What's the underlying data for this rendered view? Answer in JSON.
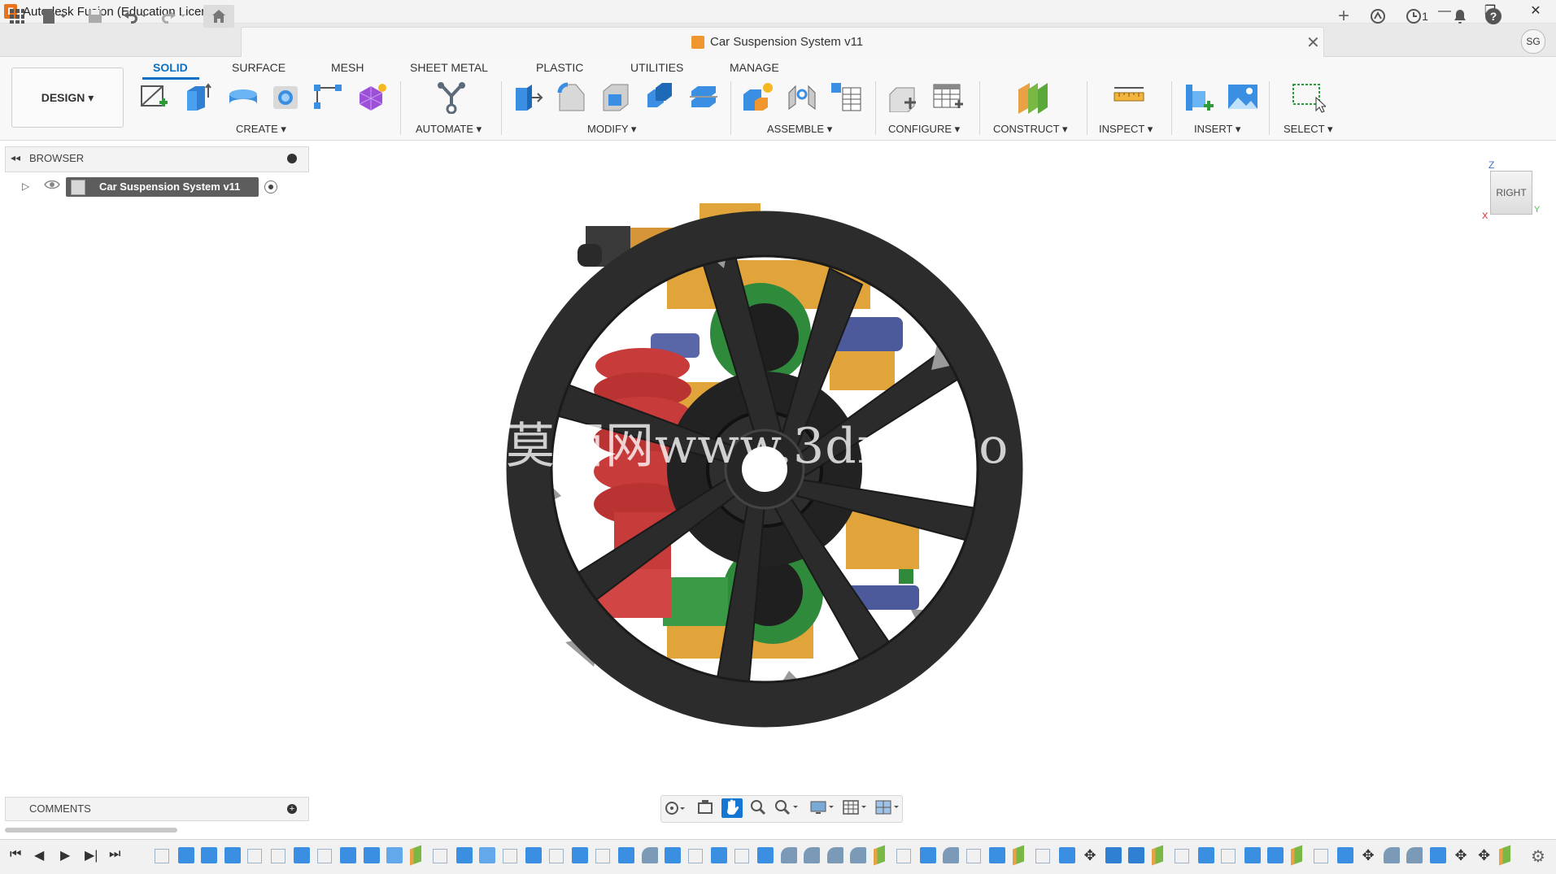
{
  "window": {
    "title": "Autodesk Fusion (Education License)",
    "app_icon_letter": "F",
    "controls": {
      "minimize": "—",
      "restore": "❐",
      "close": "✕"
    }
  },
  "quick_access": {
    "icons": [
      "data-panel-grid-icon",
      "file-icon",
      "save-icon",
      "undo-icon",
      "redo-icon",
      "home-icon"
    ],
    "right_icons": [
      "new-tab-plus-icon",
      "extensions-icon",
      "job-status-icon",
      "notifications-icon",
      "help-icon"
    ],
    "job_count": "1",
    "user_initials": "SG"
  },
  "document": {
    "title": "Car Suspension System v11",
    "close": "✕"
  },
  "ribbon": {
    "workspace": "DESIGN ▾",
    "tabs": [
      "SOLID",
      "SURFACE",
      "MESH",
      "SHEET METAL",
      "PLASTIC",
      "UTILITIES",
      "MANAGE"
    ],
    "active_tab": "SOLID",
    "groups": [
      "CREATE ▾",
      "AUTOMATE ▾",
      "MODIFY ▾",
      "ASSEMBLE ▾",
      "CONFIGURE ▾",
      "CONSTRUCT ▾",
      "INSPECT ▾",
      "INSERT ▾",
      "SELECT ▾"
    ]
  },
  "browser": {
    "label": "BROWSER",
    "collapse": "◂◂",
    "root_node": "Car Suspension System v11"
  },
  "viewcube": {
    "face": "RIGHT",
    "axis_z": "Z",
    "axis_y": "Y",
    "axis_x": "X"
  },
  "watermark": "莫西网www.3dmo  co",
  "comments": {
    "label": "COMMENTS",
    "add": "+"
  },
  "timeline": {
    "controls": [
      "⏮",
      "◀",
      "▶",
      "▶|",
      "⏭"
    ]
  },
  "colors": {
    "accent": "#0a6fc2",
    "tire": "#2c2c2c",
    "spring": "#c83b3b",
    "frame": "#e1a43b",
    "hub_green": "#2f8a3c",
    "rod_blue": "#4c5a9c"
  }
}
